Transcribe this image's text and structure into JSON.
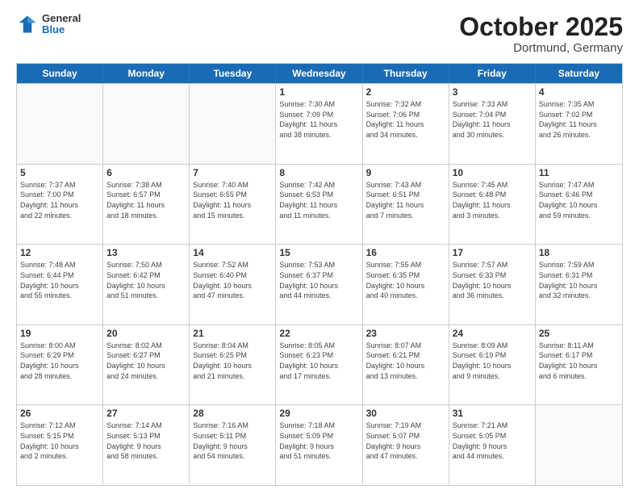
{
  "header": {
    "logo_general": "General",
    "logo_blue": "Blue",
    "month_title": "October 2025",
    "location": "Dortmund, Germany"
  },
  "weekdays": [
    "Sunday",
    "Monday",
    "Tuesday",
    "Wednesday",
    "Thursday",
    "Friday",
    "Saturday"
  ],
  "rows": [
    [
      {
        "day": "",
        "info": ""
      },
      {
        "day": "",
        "info": ""
      },
      {
        "day": "",
        "info": ""
      },
      {
        "day": "1",
        "info": "Sunrise: 7:30 AM\nSunset: 7:09 PM\nDaylight: 11 hours\nand 38 minutes."
      },
      {
        "day": "2",
        "info": "Sunrise: 7:32 AM\nSunset: 7:06 PM\nDaylight: 11 hours\nand 34 minutes."
      },
      {
        "day": "3",
        "info": "Sunrise: 7:33 AM\nSunset: 7:04 PM\nDaylight: 11 hours\nand 30 minutes."
      },
      {
        "day": "4",
        "info": "Sunrise: 7:35 AM\nSunset: 7:02 PM\nDaylight: 11 hours\nand 26 minutes."
      }
    ],
    [
      {
        "day": "5",
        "info": "Sunrise: 7:37 AM\nSunset: 7:00 PM\nDaylight: 11 hours\nand 22 minutes."
      },
      {
        "day": "6",
        "info": "Sunrise: 7:38 AM\nSunset: 6:57 PM\nDaylight: 11 hours\nand 18 minutes."
      },
      {
        "day": "7",
        "info": "Sunrise: 7:40 AM\nSunset: 6:55 PM\nDaylight: 11 hours\nand 15 minutes."
      },
      {
        "day": "8",
        "info": "Sunrise: 7:42 AM\nSunset: 6:53 PM\nDaylight: 11 hours\nand 11 minutes."
      },
      {
        "day": "9",
        "info": "Sunrise: 7:43 AM\nSunset: 6:51 PM\nDaylight: 11 hours\nand 7 minutes."
      },
      {
        "day": "10",
        "info": "Sunrise: 7:45 AM\nSunset: 6:48 PM\nDaylight: 11 hours\nand 3 minutes."
      },
      {
        "day": "11",
        "info": "Sunrise: 7:47 AM\nSunset: 6:46 PM\nDaylight: 10 hours\nand 59 minutes."
      }
    ],
    [
      {
        "day": "12",
        "info": "Sunrise: 7:48 AM\nSunset: 6:44 PM\nDaylight: 10 hours\nand 55 minutes."
      },
      {
        "day": "13",
        "info": "Sunrise: 7:50 AM\nSunset: 6:42 PM\nDaylight: 10 hours\nand 51 minutes."
      },
      {
        "day": "14",
        "info": "Sunrise: 7:52 AM\nSunset: 6:40 PM\nDaylight: 10 hours\nand 47 minutes."
      },
      {
        "day": "15",
        "info": "Sunrise: 7:53 AM\nSunset: 6:37 PM\nDaylight: 10 hours\nand 44 minutes."
      },
      {
        "day": "16",
        "info": "Sunrise: 7:55 AM\nSunset: 6:35 PM\nDaylight: 10 hours\nand 40 minutes."
      },
      {
        "day": "17",
        "info": "Sunrise: 7:57 AM\nSunset: 6:33 PM\nDaylight: 10 hours\nand 36 minutes."
      },
      {
        "day": "18",
        "info": "Sunrise: 7:59 AM\nSunset: 6:31 PM\nDaylight: 10 hours\nand 32 minutes."
      }
    ],
    [
      {
        "day": "19",
        "info": "Sunrise: 8:00 AM\nSunset: 6:29 PM\nDaylight: 10 hours\nand 28 minutes."
      },
      {
        "day": "20",
        "info": "Sunrise: 8:02 AM\nSunset: 6:27 PM\nDaylight: 10 hours\nand 24 minutes."
      },
      {
        "day": "21",
        "info": "Sunrise: 8:04 AM\nSunset: 6:25 PM\nDaylight: 10 hours\nand 21 minutes."
      },
      {
        "day": "22",
        "info": "Sunrise: 8:05 AM\nSunset: 6:23 PM\nDaylight: 10 hours\nand 17 minutes."
      },
      {
        "day": "23",
        "info": "Sunrise: 8:07 AM\nSunset: 6:21 PM\nDaylight: 10 hours\nand 13 minutes."
      },
      {
        "day": "24",
        "info": "Sunrise: 8:09 AM\nSunset: 6:19 PM\nDaylight: 10 hours\nand 9 minutes."
      },
      {
        "day": "25",
        "info": "Sunrise: 8:11 AM\nSunset: 6:17 PM\nDaylight: 10 hours\nand 6 minutes."
      }
    ],
    [
      {
        "day": "26",
        "info": "Sunrise: 7:12 AM\nSunset: 5:15 PM\nDaylight: 10 hours\nand 2 minutes."
      },
      {
        "day": "27",
        "info": "Sunrise: 7:14 AM\nSunset: 5:13 PM\nDaylight: 9 hours\nand 58 minutes."
      },
      {
        "day": "28",
        "info": "Sunrise: 7:16 AM\nSunset: 5:11 PM\nDaylight: 9 hours\nand 54 minutes."
      },
      {
        "day": "29",
        "info": "Sunrise: 7:18 AM\nSunset: 5:09 PM\nDaylight: 9 hours\nand 51 minutes."
      },
      {
        "day": "30",
        "info": "Sunrise: 7:19 AM\nSunset: 5:07 PM\nDaylight: 9 hours\nand 47 minutes."
      },
      {
        "day": "31",
        "info": "Sunrise: 7:21 AM\nSunset: 5:05 PM\nDaylight: 9 hours\nand 44 minutes."
      },
      {
        "day": "",
        "info": ""
      }
    ]
  ]
}
